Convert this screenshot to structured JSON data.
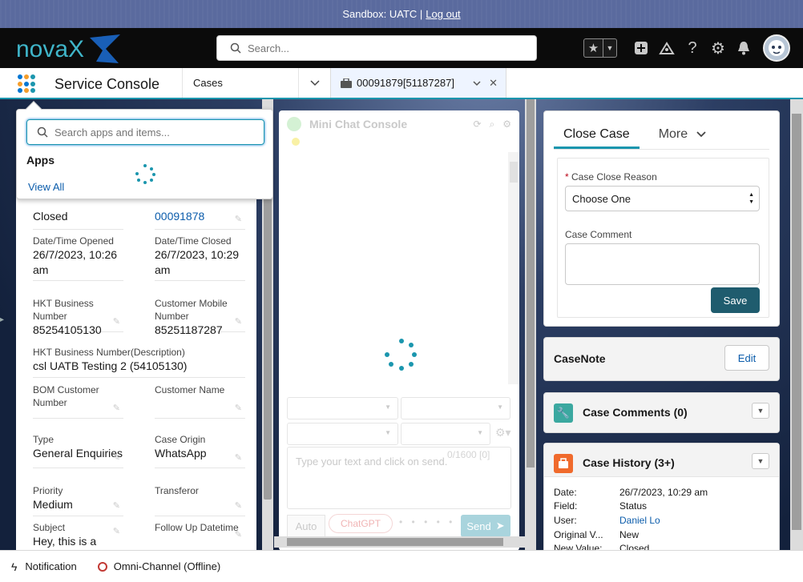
{
  "sandbox": {
    "label": "Sandbox: UATC |",
    "logout": "Log out"
  },
  "header": {
    "logo_text": "novaX",
    "search_placeholder": "Search...",
    "icons": [
      "star-icon",
      "chevron-down-icon",
      "plus-icon",
      "trailhead-icon",
      "help-icon",
      "gear-icon",
      "bell-icon",
      "avatar"
    ]
  },
  "nav": {
    "app_name": "Service Console",
    "object": "Cases",
    "tab": "00091879[51187287]"
  },
  "app_launcher": {
    "search_placeholder": "Search apps and items...",
    "apps_heading": "Apps",
    "view_all": "View All"
  },
  "case_fields": {
    "status_value": "Closed",
    "parent_case": "00091878",
    "opened_label": "Date/Time Opened",
    "opened_value": "26/7/2023, 10:26 am",
    "closed_label": "Date/Time Closed",
    "closed_value": "26/7/2023, 10:29 am",
    "hkt_label": "HKT Business Number",
    "hkt_value": "85254105130",
    "mobile_label": "Customer Mobile Number",
    "mobile_value": "85251187287",
    "hkt_desc_label": "HKT Business Number(Description)",
    "hkt_desc_value": "csl UATB Testing 2 (54105130)",
    "bom_label": "BOM Customer Number",
    "cname_label": "Customer Name",
    "type_label": "Type",
    "type_value": "General Enquiries",
    "origin_label": "Case Origin",
    "origin_value": "WhatsApp",
    "priority_label": "Priority",
    "priority_value": "Medium",
    "transferor_label": "Transferor",
    "subject_label": "Subject",
    "subject_value": "Hey, this is a Queue Waiting",
    "followup_label": "Follow Up Datetime"
  },
  "mini_chat": {
    "title": "Mini Chat Console",
    "text_placeholder": "Type your text and click on send.",
    "counter": "0/1600 [0]",
    "auto": "Auto",
    "chatgpt": "ChatGPT",
    "send": "Send"
  },
  "close_case": {
    "tab_close": "Close Case",
    "tab_more": "More",
    "reason_label": "Case Close Reason",
    "reason_value": "Choose One",
    "comment_label": "Case Comment",
    "save": "Save"
  },
  "case_note": {
    "title": "CaseNote",
    "edit": "Edit"
  },
  "case_comments": {
    "title": "Case Comments (0)"
  },
  "case_history": {
    "title": "Case History (3+)",
    "rows": [
      {
        "k": "Date:",
        "v": "26/7/2023, 10:29 am"
      },
      {
        "k": "Field:",
        "v": "Status"
      },
      {
        "k": "User:",
        "v": "Daniel Lo"
      },
      {
        "k": "Original V...",
        "v": "New"
      },
      {
        "k": "New Value:",
        "v": "Closed"
      }
    ]
  },
  "utility": {
    "notification": "Notification",
    "omni": "Omni-Channel (Offline)"
  },
  "colors": {
    "accent": "#1b96ae",
    "brand_dark": "#1f5c6e",
    "link": "#0b5cab",
    "sandbox": "#5a6a9e"
  }
}
